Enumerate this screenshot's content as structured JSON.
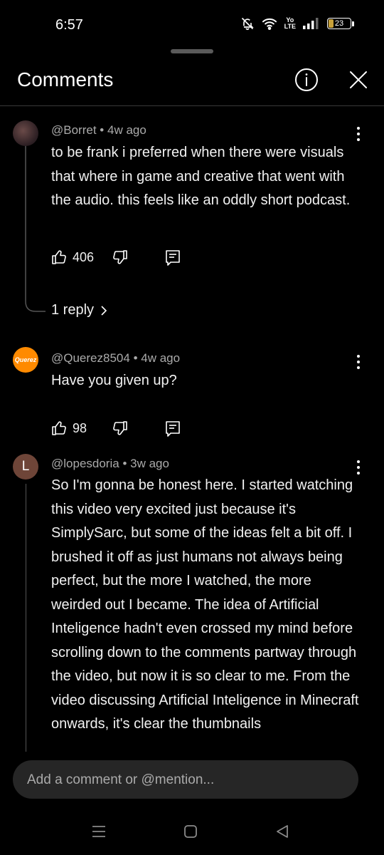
{
  "status_bar": {
    "time": "6:57",
    "volte_line1": "Yo",
    "volte_line2": "LTE",
    "battery_percent": "23",
    "battery_level": 0.23,
    "icons": [
      "bell-off-icon",
      "wifi-icon",
      "volte-icon",
      "signal-icon",
      "battery-icon"
    ]
  },
  "header": {
    "title": "Comments",
    "icons": [
      "info-icon",
      "close-icon"
    ]
  },
  "comments": [
    {
      "author": "@Borret",
      "time": "4w ago",
      "text": "to be frank i preferred when there were visuals that where in game and creative that went with the audio. this feels like an oddly short podcast.",
      "likes": "406",
      "replies_label": "1 reply",
      "avatar_kind": "photo"
    },
    {
      "author": "@Querez8504",
      "time": "4w ago",
      "text": "Have you given up?",
      "likes": "98",
      "avatar_text": "Querez"
    },
    {
      "author": "@lopesdoria",
      "time": "3w ago",
      "text": "So I'm gonna be honest here. I started watching this video very excited just because it's SimplySarc, but some of the ideas felt a bit off. I brushed it off as just humans not always being perfect, but the more I watched, the more weirded out I became. The idea of Artificial Inteligence hadn't even crossed my mind before scrolling down to the comments partway through the video, but now it is so clear to me. From the video discussing Artificial Inteligence in Minecraft onwards, it's clear the thumbnails",
      "avatar_text": "L"
    }
  ],
  "meta_separator": "•",
  "composer": {
    "placeholder": "Add a comment or @mention..."
  },
  "nav_bar": {
    "icons": [
      "menu-icon",
      "home-icon",
      "back-icon"
    ]
  },
  "colors": {
    "background": "#000000",
    "text_primary": "#f1f1f1",
    "text_secondary": "#aaaaaa",
    "composer_bg": "#262626",
    "avatar_querez": "#ff8a00",
    "avatar_l": "#6e4538",
    "battery": "#c8a13a"
  }
}
